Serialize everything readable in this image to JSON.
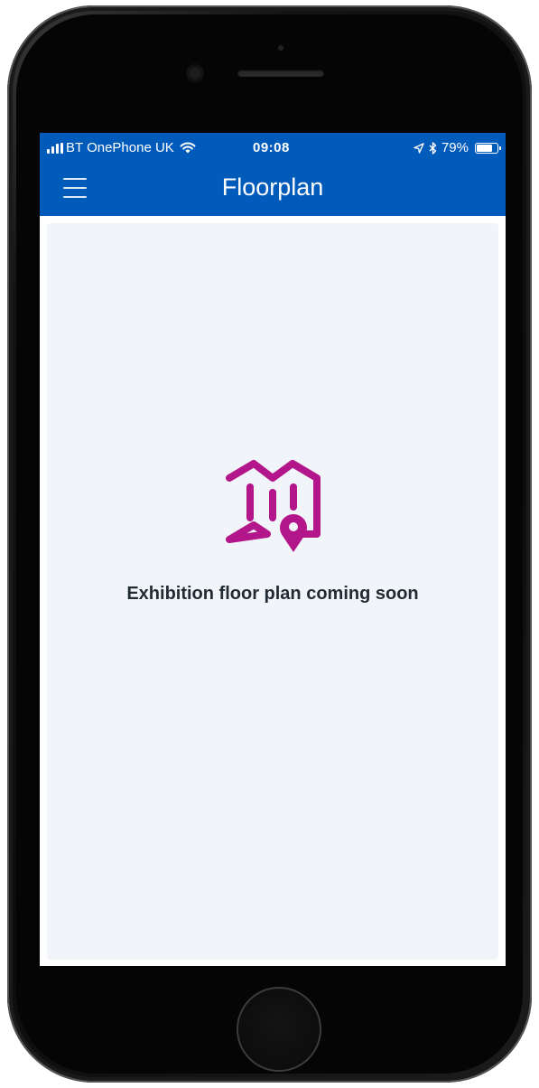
{
  "status_bar": {
    "carrier": "BT OnePhone UK",
    "time": "09:08",
    "battery_percent": "79%",
    "battery_level": 0.79,
    "icons": [
      "signal-icon",
      "wifi-icon",
      "location-arrow-icon",
      "bluetooth-icon",
      "battery-icon"
    ]
  },
  "nav": {
    "title": "Floorplan",
    "menu_icon": "hamburger-menu-icon"
  },
  "empty_state": {
    "icon": "map-pin-icon",
    "message": "Exhibition floor plan coming soon"
  },
  "colors": {
    "nav_background": "#005bbb",
    "content_background": "#f1f5f9",
    "accent": "#b3168a"
  }
}
